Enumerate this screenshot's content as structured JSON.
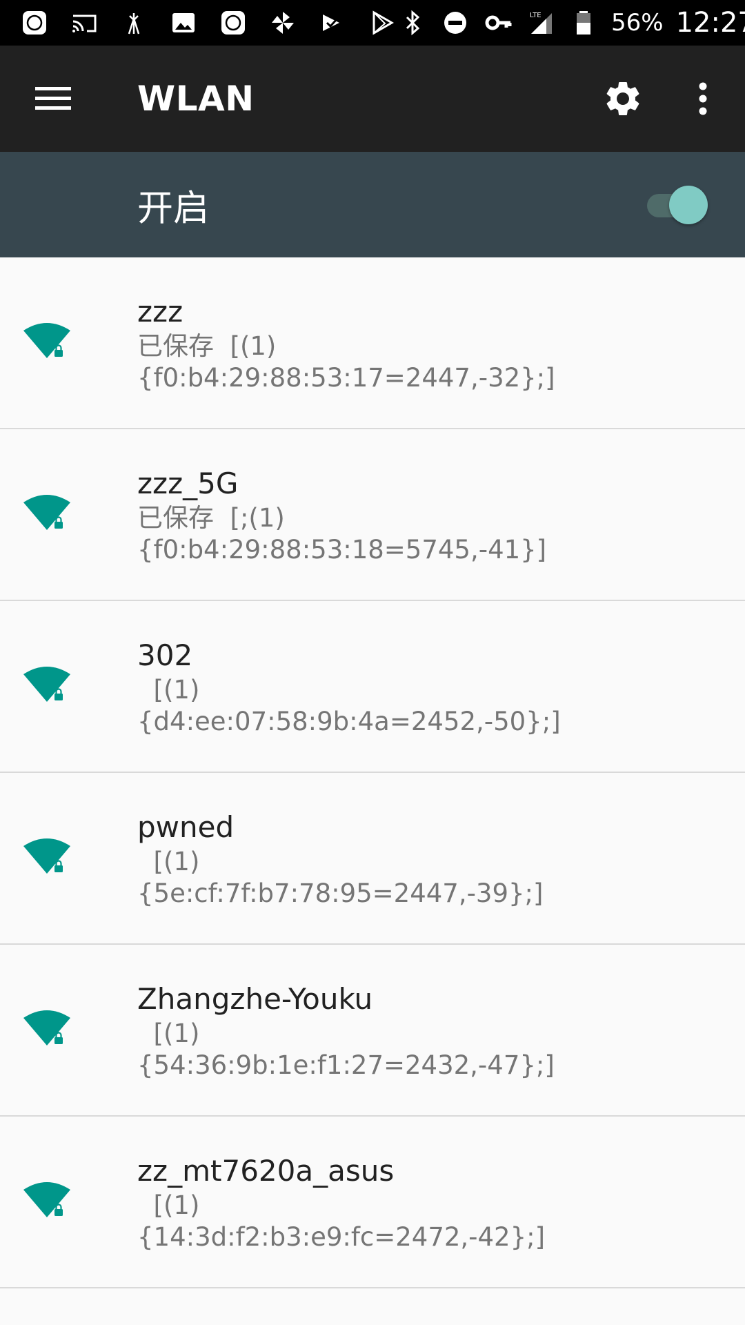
{
  "status_bar": {
    "battery_percent": "56%",
    "time": "12:27",
    "network_type": "LTE",
    "icons": [
      "mi-icon",
      "cast-icon",
      "antenna-icon",
      "image-icon",
      "mi-icon",
      "pinwheel-icon",
      "check-icon",
      "play-store-icon",
      "bluetooth-icon",
      "do-not-disturb-icon",
      "vpn-key-icon",
      "signal-icon",
      "battery-icon"
    ]
  },
  "app_bar": {
    "title": "WLAN",
    "menu_icon": "menu-icon",
    "settings_icon": "gear-icon",
    "more_icon": "more-vert-icon"
  },
  "master_switch": {
    "label": "开启",
    "checked": true,
    "accent_color": "#80cbc4"
  },
  "networks": [
    {
      "name": "zzz",
      "summary": "已保存  [(1)\n{f0:b4:29:88:53:17=2447,-32};]",
      "secured": true
    },
    {
      "name": "zzz_5G",
      "summary": "已保存  [;(1)\n{f0:b4:29:88:53:18=5745,-41}]",
      "secured": true
    },
    {
      "name": "302",
      "summary": "  [(1)\n{d4:ee:07:58:9b:4a=2452,-50};]",
      "secured": true
    },
    {
      "name": "pwned",
      "summary": "  [(1)\n{5e:cf:7f:b7:78:95=2447,-39};]",
      "secured": true
    },
    {
      "name": "Zhangzhe-Youku",
      "summary": "  [(1)\n{54:36:9b:1e:f1:27=2432,-47};]",
      "secured": true
    },
    {
      "name": "zz_mt7620a_asus",
      "summary": "  [(1)\n{14:3d:f2:b3:e9:fc=2472,-42};]",
      "secured": true
    }
  ],
  "colors": {
    "wifi_icon": "#00968a",
    "app_bar": "#212121",
    "switch_bar": "#37474f"
  }
}
